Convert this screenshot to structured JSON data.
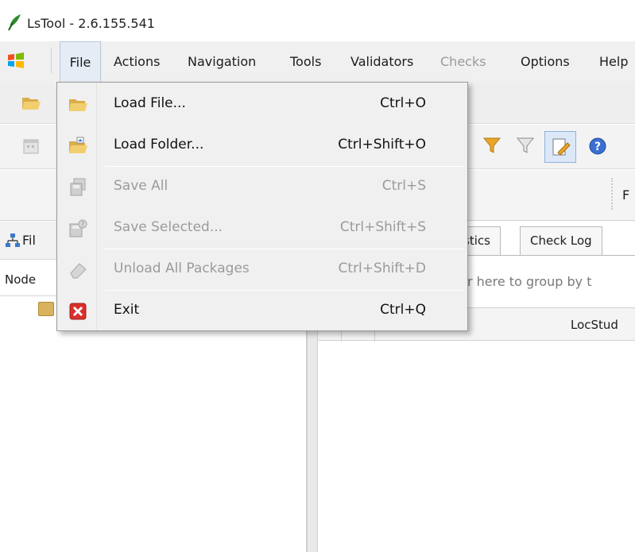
{
  "window": {
    "title": "LsTool - 2.6.155.541",
    "icon": "green-leaf-app-icon"
  },
  "menubar": {
    "items": [
      {
        "label": "File",
        "state": "open"
      },
      {
        "label": "Actions",
        "state": "enabled"
      },
      {
        "label": "Navigation",
        "state": "enabled"
      },
      {
        "label": "Tools",
        "state": "enabled"
      },
      {
        "label": "Validators",
        "state": "enabled"
      },
      {
        "label": "Checks",
        "state": "disabled"
      },
      {
        "label": "Options",
        "state": "enabled"
      },
      {
        "label": "Help",
        "state": "enabled"
      }
    ]
  },
  "file_menu": {
    "items": [
      {
        "label": "Load File...",
        "shortcut": "Ctrl+O",
        "enabled": true,
        "icon": "open-folder-icon"
      },
      {
        "label": "Load Folder...",
        "shortcut": "Ctrl+Shift+O",
        "enabled": true,
        "icon": "load-folder-icon"
      },
      {
        "label": "Save All",
        "shortcut": "Ctrl+S",
        "enabled": false,
        "icon": "save-all-icon"
      },
      {
        "label": "Save Selected...",
        "shortcut": "Ctrl+Shift+S",
        "enabled": false,
        "icon": "save-selected-icon"
      },
      {
        "label": "Unload All Packages",
        "shortcut": "Ctrl+Shift+D",
        "enabled": false,
        "icon": "eraser-icon"
      },
      {
        "label": "Exit",
        "shortcut": "Ctrl+Q",
        "enabled": true,
        "icon": "exit-icon"
      }
    ]
  },
  "toolbar": {
    "partial_label": "F"
  },
  "left_pane": {
    "header": "Fil",
    "column_header": "Node"
  },
  "right_pane": {
    "tabs": [
      {
        "label": "stics",
        "active": false
      },
      {
        "label": "Check Log",
        "active": false
      }
    ],
    "group_hint": "der here to group by t",
    "grid_columns": [
      "LocStud"
    ]
  },
  "colors": {
    "menu_open_bg": "#e6ecf5",
    "menu_bg": "#f0f0f0",
    "exit_red": "#d9302c",
    "folder_yellow": "#e8c15a",
    "filter_orange": "#e8a526",
    "help_blue": "#3b6fd1"
  }
}
